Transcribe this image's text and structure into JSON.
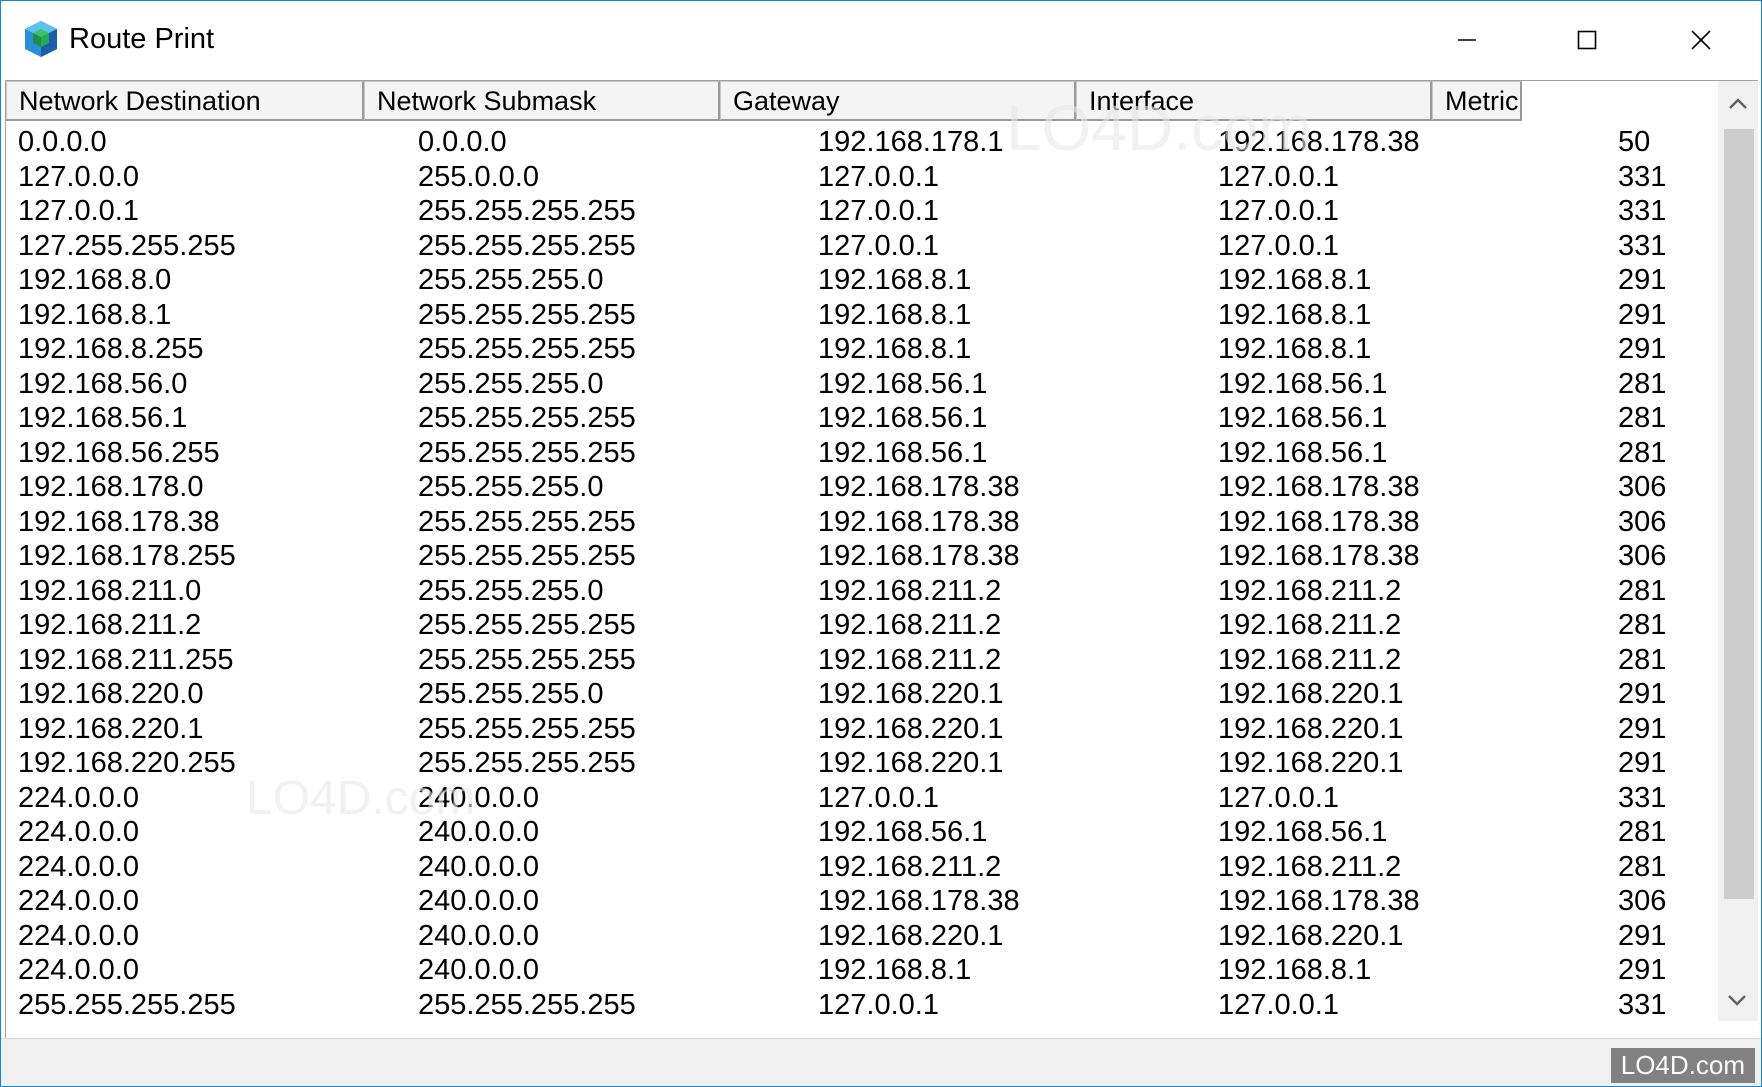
{
  "window": {
    "title": "Route Print"
  },
  "columns": [
    "Network Destination",
    "Network Submask",
    "Gateway",
    "Interface",
    "Metric"
  ],
  "rows": [
    [
      "0.0.0.0",
      "0.0.0.0",
      "192.168.178.1",
      "192.168.178.38",
      "50"
    ],
    [
      "127.0.0.0",
      "255.0.0.0",
      "127.0.0.1",
      "127.0.0.1",
      "331"
    ],
    [
      "127.0.0.1",
      "255.255.255.255",
      "127.0.0.1",
      "127.0.0.1",
      "331"
    ],
    [
      "127.255.255.255",
      "255.255.255.255",
      "127.0.0.1",
      "127.0.0.1",
      "331"
    ],
    [
      "192.168.8.0",
      "255.255.255.0",
      "192.168.8.1",
      "192.168.8.1",
      "291"
    ],
    [
      "192.168.8.1",
      "255.255.255.255",
      "192.168.8.1",
      "192.168.8.1",
      "291"
    ],
    [
      "192.168.8.255",
      "255.255.255.255",
      "192.168.8.1",
      "192.168.8.1",
      "291"
    ],
    [
      "192.168.56.0",
      "255.255.255.0",
      "192.168.56.1",
      "192.168.56.1",
      "281"
    ],
    [
      "192.168.56.1",
      "255.255.255.255",
      "192.168.56.1",
      "192.168.56.1",
      "281"
    ],
    [
      "192.168.56.255",
      "255.255.255.255",
      "192.168.56.1",
      "192.168.56.1",
      "281"
    ],
    [
      "192.168.178.0",
      "255.255.255.0",
      "192.168.178.38",
      "192.168.178.38",
      "306"
    ],
    [
      "192.168.178.38",
      "255.255.255.255",
      "192.168.178.38",
      "192.168.178.38",
      "306"
    ],
    [
      "192.168.178.255",
      "255.255.255.255",
      "192.168.178.38",
      "192.168.178.38",
      "306"
    ],
    [
      "192.168.211.0",
      "255.255.255.0",
      "192.168.211.2",
      "192.168.211.2",
      "281"
    ],
    [
      "192.168.211.2",
      "255.255.255.255",
      "192.168.211.2",
      "192.168.211.2",
      "281"
    ],
    [
      "192.168.211.255",
      "255.255.255.255",
      "192.168.211.2",
      "192.168.211.2",
      "281"
    ],
    [
      "192.168.220.0",
      "255.255.255.0",
      "192.168.220.1",
      "192.168.220.1",
      "291"
    ],
    [
      "192.168.220.1",
      "255.255.255.255",
      "192.168.220.1",
      "192.168.220.1",
      "291"
    ],
    [
      "192.168.220.255",
      "255.255.255.255",
      "192.168.220.1",
      "192.168.220.1",
      "291"
    ],
    [
      "224.0.0.0",
      "240.0.0.0",
      "127.0.0.1",
      "127.0.0.1",
      "331"
    ],
    [
      "224.0.0.0",
      "240.0.0.0",
      "192.168.56.1",
      "192.168.56.1",
      "281"
    ],
    [
      "224.0.0.0",
      "240.0.0.0",
      "192.168.211.2",
      "192.168.211.2",
      "281"
    ],
    [
      "224.0.0.0",
      "240.0.0.0",
      "192.168.178.38",
      "192.168.178.38",
      "306"
    ],
    [
      "224.0.0.0",
      "240.0.0.0",
      "192.168.220.1",
      "192.168.220.1",
      "291"
    ],
    [
      "224.0.0.0",
      "240.0.0.0",
      "192.168.8.1",
      "192.168.8.1",
      "291"
    ],
    [
      "255.255.255.255",
      "255.255.255.255",
      "127.0.0.1",
      "127.0.0.1",
      "331"
    ]
  ],
  "watermark": {
    "text": "LO4D.com"
  },
  "icons": {
    "app": "cube-icon",
    "minimize": "minimize-icon",
    "maximize": "maximize-icon",
    "close": "close-icon",
    "scroll_up": "chevron-up-icon",
    "scroll_down": "chevron-down-icon"
  },
  "colors": {
    "window_border": "#1883d7",
    "header_bg": "#f4f4f4",
    "scrollbar_bg": "#f0f0f0",
    "scroll_thumb": "#cdcdcd"
  }
}
